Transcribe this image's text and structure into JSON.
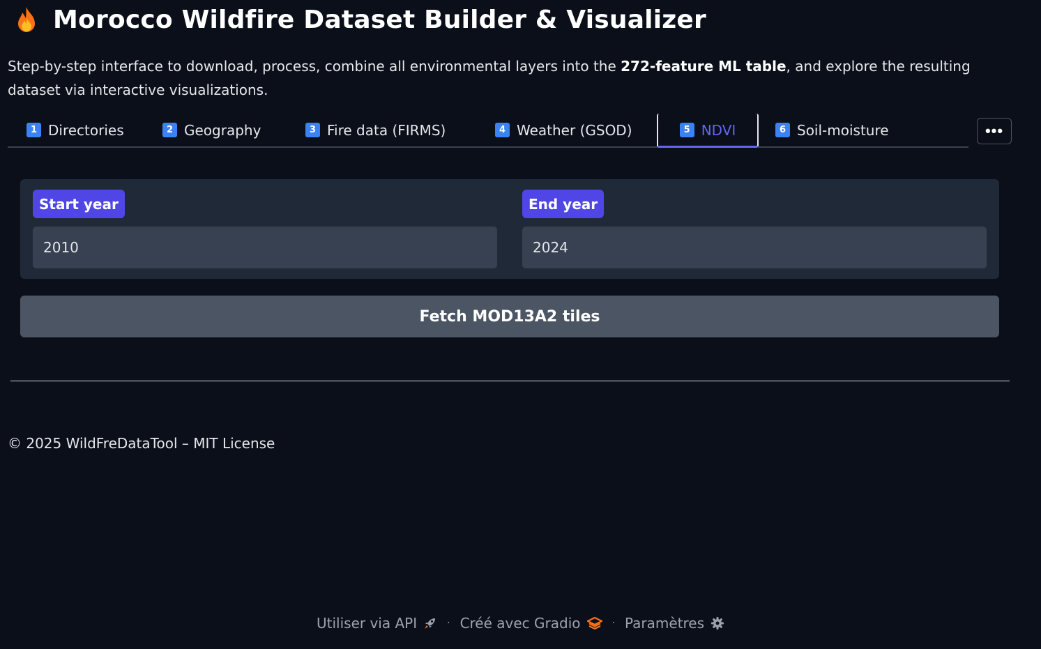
{
  "header": {
    "title": "Morocco Wildfire Dataset Builder & Visualizer",
    "icon": "fire-icon"
  },
  "description": {
    "part1": "Step-by-step interface to download, process, combine all environmental layers into the ",
    "bold": "272-feature ML table",
    "part2": ", and explore the resulting dataset via interactive visualizations."
  },
  "tabs": [
    {
      "num": "1",
      "label": "Directories",
      "active": false
    },
    {
      "num": "2",
      "label": "Geography",
      "active": false
    },
    {
      "num": "3",
      "label": "Fire data (FIRMS)",
      "active": false
    },
    {
      "num": "4",
      "label": "Weather (GSOD)",
      "active": false
    },
    {
      "num": "5",
      "label": "NDVI",
      "active": true
    },
    {
      "num": "6",
      "label": "Soil-moisture",
      "active": false
    }
  ],
  "more_button": "•••",
  "form": {
    "start_year_label": "Start year",
    "start_year_value": "2010",
    "end_year_label": "End year",
    "end_year_value": "2024"
  },
  "fetch_button_label": "Fetch MOD13A2 tiles",
  "copyright": "© 2025 WildFreDataTool – MIT License",
  "footer": {
    "api_label": "Utiliser via API",
    "api_icon": "rocket-icon",
    "gradio_label": "Créé avec Gradio",
    "gradio_icon": "gradio-logo-icon",
    "settings_label": "Paramètres",
    "settings_icon": "gear-icon",
    "separator": "·"
  },
  "colors": {
    "background": "#0b0f19",
    "accent": "#6366f1",
    "label_bg": "#4f46e5",
    "tab_number_bg": "#3b82f6"
  }
}
